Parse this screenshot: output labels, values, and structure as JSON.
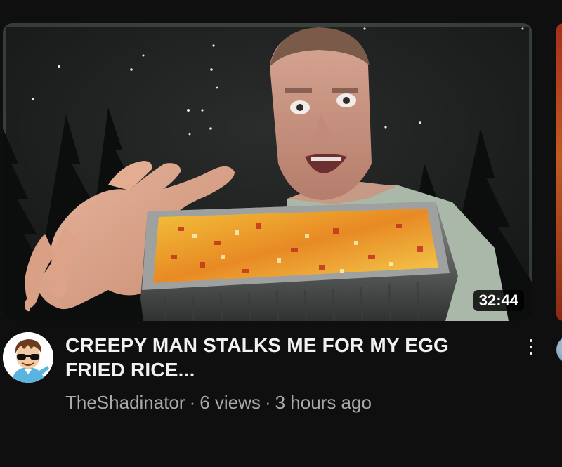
{
  "video": {
    "title": "CREEPY MAN STALKS ME FOR MY EGG FRIED RICE...",
    "duration": "32:44",
    "channel": "TheShadinator",
    "views": "6 views",
    "age": "3 hours ago",
    "separator": "·"
  },
  "icons": {
    "more": "vertical-ellipsis-icon",
    "avatar": "cartoon-boy-sunglasses-avatar"
  },
  "colors": {
    "background": "#0f0f0f",
    "title_text": "#f1f1f1",
    "meta_text": "#aaaaaa",
    "badge_bg": "#000000"
  }
}
